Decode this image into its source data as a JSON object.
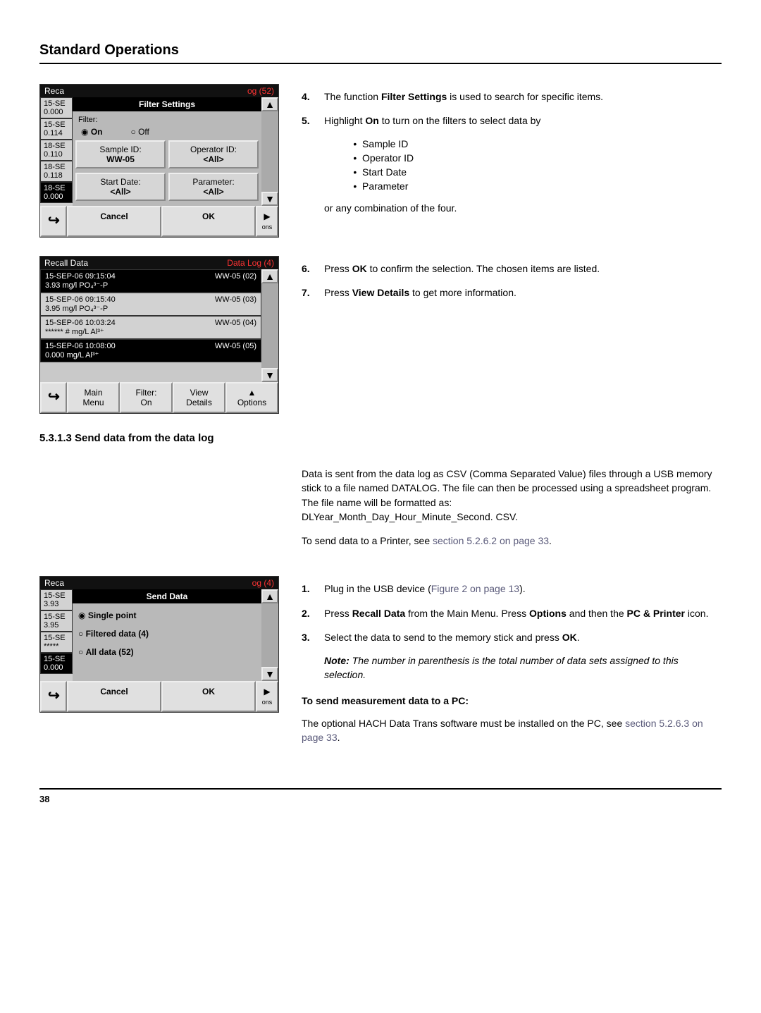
{
  "page": {
    "heading": "Standard Operations",
    "footer_page": "38"
  },
  "dev1": {
    "title_left": "Reca",
    "title_right": "og (52)",
    "dialog_title": "Filter Settings",
    "sidebar": [
      {
        "l1": "15-SE",
        "l2": "0.000"
      },
      {
        "l1": "15-SE",
        "l2": "0.114"
      },
      {
        "l1": "18-SE",
        "l2": "0.110"
      },
      {
        "l1": "18-SE",
        "l2": "0.118"
      },
      {
        "l1": "18-SE",
        "l2": "0.000"
      }
    ],
    "filter_label": "Filter:",
    "radio_on": "On",
    "radio_off": "Off",
    "sample_id_lbl": "Sample ID:",
    "sample_id_val": "WW-05",
    "operator_id_lbl": "Operator ID:",
    "operator_id_val": "<All>",
    "startdate_lbl": "Start Date:",
    "startdate_val": "<All>",
    "parameter_lbl": "Parameter:",
    "parameter_val": "<All>",
    "cancel": "Cancel",
    "ok": "OK",
    "ons": "ons"
  },
  "dev2": {
    "title_left": "Recall Data",
    "title_right": "Data Log (4)",
    "rows": [
      {
        "l1": "15-SEP-06  09:15:04",
        "l2": "3.93  mg/l  PO₄³⁻-P",
        "r": "WW-05 (02)"
      },
      {
        "l1": "15-SEP-06  09:15:40",
        "l2": "3.95  mg/l  PO₄³⁻-P",
        "r": "WW-05 (03)"
      },
      {
        "l1": "15-SEP-06  10:03:24",
        "l2": "******  #  mg/L  Al³⁺",
        "r": "WW-05 (04)"
      },
      {
        "l1": "15-SEP-06  10:08:00",
        "l2": "0.000  mg/L  Al³⁺",
        "r": "WW-05 (05)"
      }
    ],
    "btn_main": "Main\nMenu",
    "btn_filter": "Filter:\nOn",
    "btn_view": "View\nDetails",
    "btn_options": "Options"
  },
  "dev3": {
    "title_left": "Reca",
    "title_right": "og (4)",
    "dialog_title": "Send Data",
    "sidebar": [
      {
        "l1": "15-SE",
        "l2": "3.93"
      },
      {
        "l1": "15-SE",
        "l2": "3.95"
      },
      {
        "l1": "15-SE",
        "l2": "*****"
      },
      {
        "l1": "15-SE",
        "l2": "0.000"
      }
    ],
    "opt_single": "Single point",
    "opt_filtered": "Filtered data (4)",
    "opt_all": "All data (52)",
    "cancel": "Cancel",
    "ok": "OK",
    "ons": "ons"
  },
  "text": {
    "step4_n": "4.",
    "step4": "The function ",
    "step4b": "Filter Settings",
    "step4c": " is used to search for specific items.",
    "step5_n": "5.",
    "step5a": "Highlight ",
    "step5b": "On",
    "step5c": " to turn on the filters to select data by",
    "sub1": "Sample ID",
    "sub2": "Operator ID",
    "sub3": "Start Date",
    "sub4": "Parameter",
    "step5d": "or any combination of the four.",
    "step6_n": "6.",
    "step6a": "Press ",
    "step6b": "OK",
    "step6c": " to confirm the selection. The chosen items are listed.",
    "step7_n": "7.",
    "step7a": "Press ",
    "step7b": "View Details",
    "step7c": " to get more information.",
    "section_heading": "5.3.1.3  Send data from the data log",
    "para1": "Data is sent from the data log as CSV (Comma Separated Value) files through a USB memory stick to a file named DATALOG. The file can then be processed using a spreadsheet program. The file name will be formatted as:",
    "para1b": "DLYear_Month_Day_Hour_Minute_Second. CSV.",
    "para2a": "To send data to a Printer, see ",
    "para2b": "section 5.2.6.2 on page 33",
    "para2c": ".",
    "s1_n": "1.",
    "s1a": "Plug in the USB device (",
    "s1b": "Figure 2 on page 13",
    "s1c": ").",
    "s2_n": "2.",
    "s2a": "Press ",
    "s2b": "Recall Data",
    "s2c": " from the Main Menu. Press ",
    "s2d": "Options",
    "s2e": " and then the ",
    "s2f": "PC & Printer",
    "s2g": " icon.",
    "s3_n": "3.",
    "s3a": "Select the data to send to the memory stick and press ",
    "s3b": "OK",
    "s3c": ".",
    "note_lbl": "Note:",
    "note_txt": " The number in parenthesis is the total number of data sets assigned to this selection.",
    "pc_head": "To send measurement data to a PC:",
    "pc_txt_a": "The optional HACH Data Trans software must be installed on the PC, see ",
    "pc_txt_b": "section 5.2.6.3 on page 33",
    "pc_txt_c": "."
  }
}
